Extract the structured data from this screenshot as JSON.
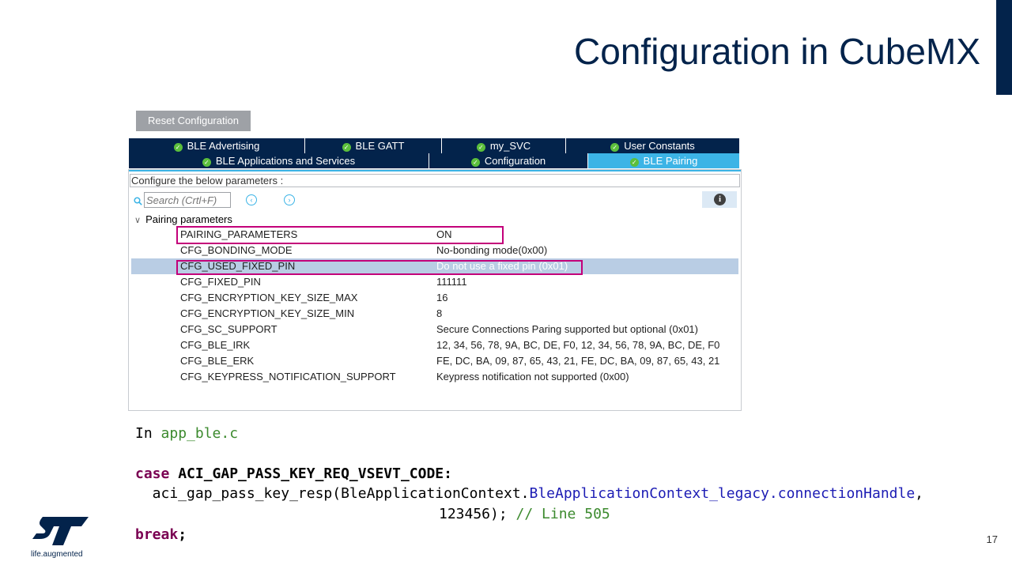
{
  "slide": {
    "title": "Configuration in CubeMX",
    "page_number": "17",
    "tagline": "life.augmented"
  },
  "toolbar": {
    "reset_label": "Reset Configuration"
  },
  "tabs": {
    "row1": [
      {
        "label": "BLE Advertising"
      },
      {
        "label": "BLE GATT"
      },
      {
        "label": "my_SVC"
      },
      {
        "label": "User Constants"
      }
    ],
    "row2": [
      {
        "label": "BLE Applications and Services"
      },
      {
        "label": "Configuration"
      },
      {
        "label": "BLE Pairing",
        "active": true
      }
    ]
  },
  "panel": {
    "configure_label": "Configure the below parameters :",
    "search_placeholder": "Search (Crtl+F)",
    "group_label": "Pairing parameters",
    "params": [
      {
        "name": "PAIRING_PARAMETERS",
        "value": "ON"
      },
      {
        "name": "CFG_BONDING_MODE",
        "value": "No-bonding mode(0x00)"
      },
      {
        "name": "CFG_USED_FIXED_PIN",
        "value": "Do not use a fixed pin (0x01)",
        "selected": true
      },
      {
        "name": "CFG_FIXED_PIN",
        "value": "111111"
      },
      {
        "name": "CFG_ENCRYPTION_KEY_SIZE_MAX",
        "value": "16"
      },
      {
        "name": "CFG_ENCRYPTION_KEY_SIZE_MIN",
        "value": "8"
      },
      {
        "name": "CFG_SC_SUPPORT",
        "value": "Secure Connections Paring supported but optional (0x01)"
      },
      {
        "name": "CFG_BLE_IRK",
        "value": "12, 34, 56, 78, 9A, BC, DE, F0, 12, 34, 56, 78, 9A, BC, DE, F0"
      },
      {
        "name": "CFG_BLE_ERK",
        "value": "FE, DC, BA, 09, 87, 65, 43, 21, FE, DC, BA, 09, 87, 65, 43, 21"
      },
      {
        "name": "CFG_KEYPRESS_NOTIFICATION_SUPPORT",
        "value": "Keypress notification not supported (0x00)"
      }
    ]
  },
  "code": {
    "intro_prefix": "In ",
    "intro_file": "app_ble.c",
    "case_kw": "case",
    "case_label": " ACI_GAP_PASS_KEY_REQ_VSEVT_CODE:",
    "call_prefix": "  aci_gap_pass_key_resp(BleApplicationContext.",
    "call_member": "BleApplicationContext_legacy.connectionHandle",
    "call_suffix": ",",
    "arg_value": "123456);",
    "comment": " // Line 505",
    "break_kw": "break",
    "break_suffix": ";"
  },
  "colors": {
    "brand_navy": "#03234b",
    "tab_active": "#3cb4e6",
    "highlight_box": "#c3007a",
    "selected_row": "#b9cde4"
  },
  "icons": [
    "check-circle-icon",
    "search-icon",
    "chevron-left-icon",
    "chevron-right-icon",
    "info-icon",
    "chevron-down-icon",
    "st-logo"
  ]
}
